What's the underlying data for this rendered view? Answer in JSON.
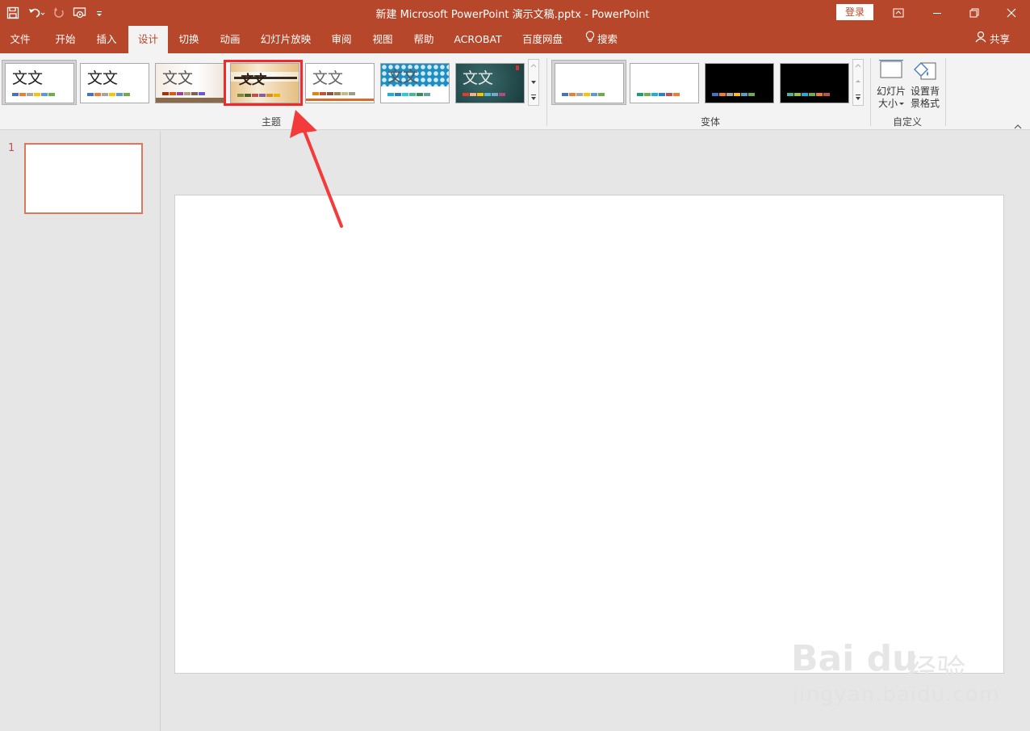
{
  "window": {
    "title": "新建 Microsoft PowerPoint 演示文稿.pptx  -  PowerPoint",
    "login_label": "登录"
  },
  "tabs": [
    {
      "label": "文件"
    },
    {
      "label": "开始"
    },
    {
      "label": "插入"
    },
    {
      "label": "设计"
    },
    {
      "label": "切换"
    },
    {
      "label": "动画"
    },
    {
      "label": "幻灯片放映"
    },
    {
      "label": "审阅"
    },
    {
      "label": "视图"
    },
    {
      "label": "帮助"
    },
    {
      "label": "ACROBAT"
    },
    {
      "label": "百度网盘"
    },
    {
      "label": "搜索"
    }
  ],
  "share_label": "共享",
  "ribbon": {
    "themes_label": "主题",
    "variants_label": "变体",
    "customize_label": "自定义",
    "themes": [
      {
        "text": "文文",
        "colors": [
          "#4472c4",
          "#ed7d31",
          "#a5a5a5",
          "#ffc000",
          "#5b9bd5",
          "#70ad47"
        ]
      },
      {
        "text": "文文",
        "colors": [
          "#4472c4",
          "#ed7d31",
          "#a5a5a5",
          "#ffc000",
          "#5b9bd5",
          "#70ad47"
        ]
      },
      {
        "text": "文文",
        "colors": [
          "#a5300f",
          "#d55816",
          "#e19825",
          "#b19c7d",
          "#7f5f52",
          "#b27d49"
        ]
      },
      {
        "text": "文文",
        "colors": [
          "#629dd1",
          "#297fd5",
          "#7f8fa9",
          "#4a66ac",
          "#5aa2ae",
          "#9d90a0"
        ]
      },
      {
        "text": "文文",
        "colors": [
          "#e48312",
          "#bd582c",
          "#865640",
          "#9b8357",
          "#c2bc80",
          "#94a088"
        ]
      },
      {
        "text": "文文",
        "colors": [
          "#1cade4",
          "#2683c6",
          "#27ced7",
          "#42ba97",
          "#3e8853",
          "#62a39f"
        ]
      },
      {
        "text": "文文",
        "colors": [
          "#e23d28",
          "#f4b183",
          "#ffc000",
          "#5bb9c9",
          "#74a7cc",
          "#ae4b7f"
        ]
      }
    ],
    "variants": [
      {
        "colors": [
          "#4472c4",
          "#ed7d31",
          "#a5a5a5",
          "#ffc000",
          "#5b9bd5",
          "#70ad47"
        ]
      },
      {
        "colors": [
          "#0f9ed5",
          "#e97132",
          "#196b24",
          "#0f9ed5",
          "#a02b93",
          "#4ea72e"
        ]
      },
      {
        "colors": [
          "#4472c4",
          "#ed7d31",
          "#a5a5a5",
          "#ffc000",
          "#5b9bd5",
          "#70ad47"
        ]
      },
      {
        "colors": [
          "#70ad47",
          "#9bc23c",
          "#1cade4",
          "#42ba97",
          "#ed7d31",
          "#c0504d"
        ]
      }
    ],
    "slide_size_label_1": "幻灯片",
    "slide_size_label_2": "大小",
    "format_bg_label_1": "设置背",
    "format_bg_label_2": "景格式"
  },
  "slides_pane": {
    "slide_number": "1"
  },
  "watermark": {
    "logo_text": "Bai du",
    "jingyan": "经验",
    "url": "jingyan.baidu.com"
  }
}
